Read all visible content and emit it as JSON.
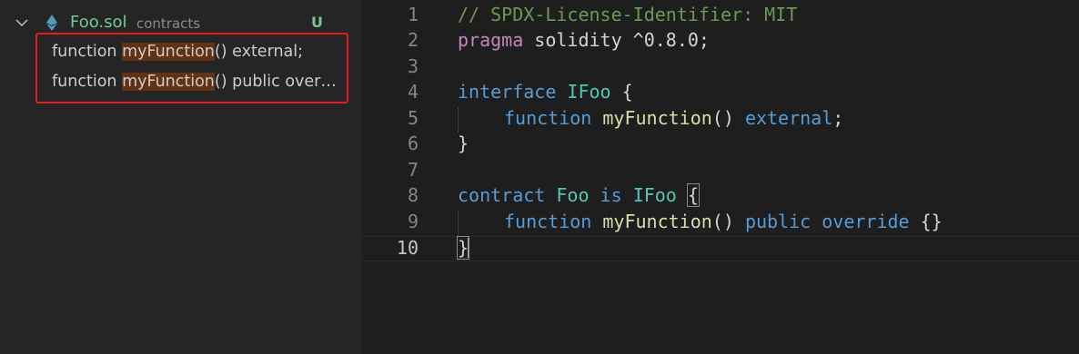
{
  "explorer": {
    "file_name": "Foo.sol",
    "file_dir": "contracts",
    "file_status": "U",
    "results": [
      {
        "prefix": "function ",
        "match": "myFunction",
        "suffix": "() external;"
      },
      {
        "prefix": "function ",
        "match": "myFunction",
        "suffix": "() public over…"
      }
    ]
  },
  "editor": {
    "line_numbers": [
      "1",
      "2",
      "3",
      "4",
      "5",
      "6",
      "7",
      "8",
      "9",
      "10"
    ],
    "lines": {
      "l1": "// SPDX-License-Identifier: MIT",
      "l2_kw": "pragma",
      "l2_rest": " solidity ^0.8.0;",
      "l4_kw": "interface",
      "l4_name": "IFoo",
      "l4_brace": " {",
      "l5_kw": "function",
      "l5_fn": "myFunction",
      "l5_paren": "()",
      "l5_mod": "external",
      "l5_end": ";",
      "l6": "}",
      "l8_kw": "contract",
      "l8_name": "Foo",
      "l8_is": "is",
      "l8_base": "IFoo",
      "l8_brace": "{",
      "l9_kw": "function",
      "l9_fn": "myFunction",
      "l9_paren": "()",
      "l9_pub": "public",
      "l9_ovr": "override",
      "l9_body": "{}",
      "l10": "}"
    }
  },
  "colors": {
    "added_file": "#73c991",
    "match_highlight": "#613214",
    "selection_box": "#e51c23"
  }
}
